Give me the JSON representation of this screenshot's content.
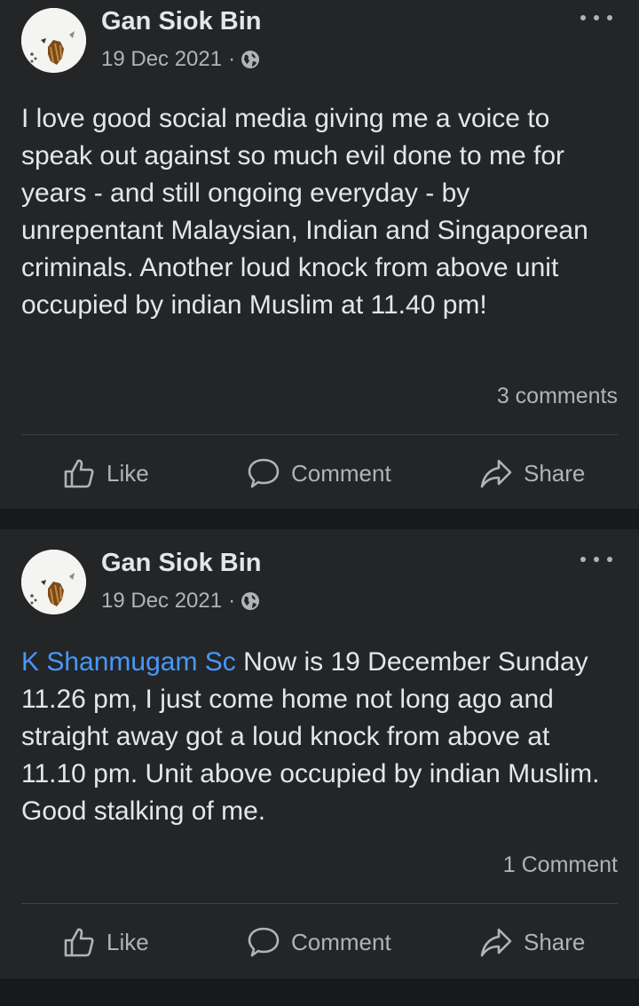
{
  "posts": [
    {
      "author": "Gan Siok Bin",
      "date": "19 Dec 2021",
      "separator": "·",
      "audience_icon": "globe-icon",
      "text_mention": "",
      "text": "I love good social media giving me a voice to speak out against so much evil done to me for years - and still ongoing everyday - by unrepentant Malaysian, Indian and Singaporean criminals. Another loud knock from above unit occupied by indian Muslim at 11.40 pm!",
      "comments_label": "3 comments",
      "actions": {
        "like": "Like",
        "comment": "Comment",
        "share": "Share"
      }
    },
    {
      "author": "Gan Siok Bin",
      "date": "19 Dec 2021",
      "separator": "·",
      "audience_icon": "globe-icon",
      "text_mention": "K Shanmugam Sc",
      "text": " Now is 19 December Sunday 11.26 pm, I just come home not long ago and straight away got a loud knock from above at 11.10 pm. Unit above occupied by indian Muslim. Good stalking of me.",
      "comments_label": "1 Comment",
      "actions": {
        "like": "Like",
        "comment": "Comment",
        "share": "Share"
      }
    }
  ],
  "colors": {
    "background": "#18191a",
    "card": "#242526",
    "primary_text": "#e4e6eb",
    "secondary_text": "#b0b3b8",
    "mention": "#4599ff"
  }
}
